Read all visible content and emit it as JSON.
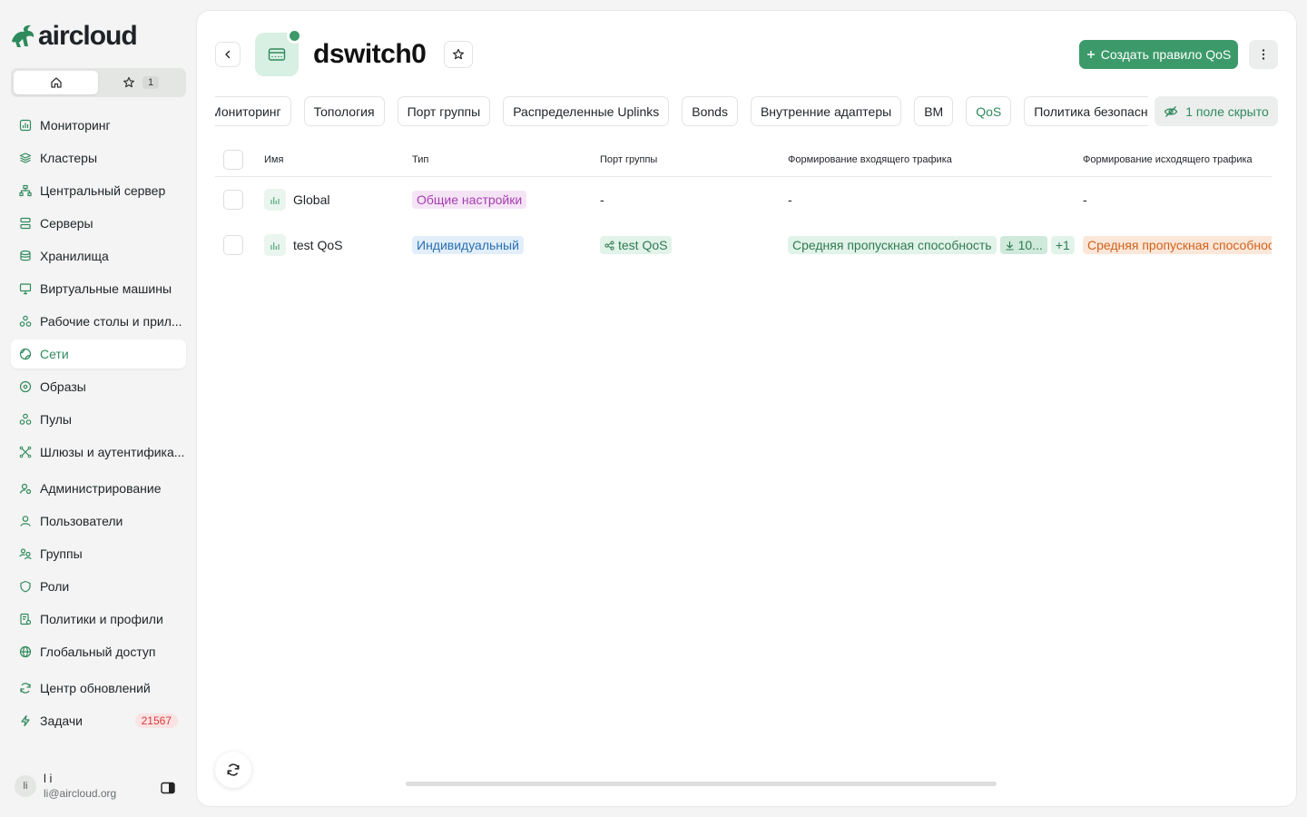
{
  "app": {
    "logo_text": "aircloud"
  },
  "switcher": {
    "favorites_count": "1"
  },
  "sidebar": {
    "items": [
      {
        "label": "Мониторинг",
        "icon": "chart-icon"
      },
      {
        "label": "Кластеры",
        "icon": "layers-icon"
      },
      {
        "label": "Центральный сервер",
        "icon": "hierarchy-icon"
      },
      {
        "label": "Серверы",
        "icon": "server-icon"
      },
      {
        "label": "Хранилища",
        "icon": "database-icon"
      },
      {
        "label": "Виртуальные машины",
        "icon": "monitor-icon"
      },
      {
        "label": "Рабочие столы и прил...",
        "icon": "apps-icon"
      },
      {
        "label": "Сети",
        "icon": "globe-icon",
        "active": true
      },
      {
        "label": "Образы",
        "icon": "disc-icon"
      },
      {
        "label": "Пулы",
        "icon": "pool-icon"
      },
      {
        "label": "Шлюзы и аутентифика...",
        "icon": "gateway-icon"
      },
      {
        "label": "Администрирование",
        "icon": "admin-icon"
      },
      {
        "label": "Пользователи",
        "icon": "user-icon"
      },
      {
        "label": "Группы",
        "icon": "group-icon"
      },
      {
        "label": "Роли",
        "icon": "shield-icon"
      },
      {
        "label": "Политики и профили",
        "icon": "policy-icon"
      },
      {
        "label": "Глобальный доступ",
        "icon": "globe-access-icon"
      },
      {
        "label": "Центр обновлений",
        "icon": "refresh-icon"
      },
      {
        "label": "Задачи",
        "icon": "bolt-icon",
        "badge": "21567"
      }
    ]
  },
  "user": {
    "initials": "li",
    "name": "l i",
    "email": "li@aircloud.org"
  },
  "header": {
    "title": "dswitch0",
    "create_label": "Создать правило QoS",
    "hidden_fields_label": "1 поле скрыто"
  },
  "tabs": [
    {
      "label": "Мониторинг"
    },
    {
      "label": "Топология"
    },
    {
      "label": "Порт группы"
    },
    {
      "label": "Распределенные Uplinks"
    },
    {
      "label": "Bonds"
    },
    {
      "label": "Внутренние адаптеры"
    },
    {
      "label": "ВМ"
    },
    {
      "label": "QoS",
      "active": true
    },
    {
      "label": "Политика безопасности"
    }
  ],
  "table": {
    "columns": [
      "Имя",
      "Тип",
      "Порт группы",
      "Формирование входящего трафика",
      "Формирование исходящего трафика"
    ],
    "rows": [
      {
        "name": "Global",
        "type": "Общие настройки",
        "port_groups": "-",
        "ingress": "-",
        "egress": "-"
      },
      {
        "name": "test QoS",
        "type": "Индивидуальный",
        "port_groups": "test QoS",
        "ingress": "Средняя пропускная способность",
        "ingress_value": "10...",
        "ingress_more": "+1",
        "egress": "Средняя пропускная способнос"
      }
    ]
  },
  "colors": {
    "accent": "#3c9a6a",
    "accent_text": "#2f8a5d"
  }
}
